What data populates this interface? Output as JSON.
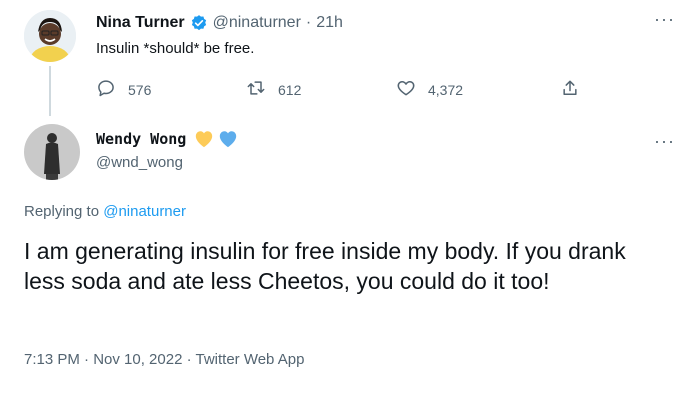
{
  "parent_tweet": {
    "display_name": "Nina Turner",
    "handle": "@ninaturner",
    "time_ago": "21h",
    "separator": "·",
    "text": "Insulin *should* be free.",
    "replies": "576",
    "retweets": "612",
    "likes": "4,372",
    "verified_color": "#1d9bf0"
  },
  "main_tweet": {
    "display_name": "Wendy Wong",
    "emoji_hearts": [
      "yellow-heart",
      "blue-heart"
    ],
    "handle": "@wnd_wong",
    "replying_prefix": "Replying to",
    "replying_to": "@ninaturner",
    "text": "I am generating insulin for free inside my body. If you drank less soda and ate less Cheetos, you could do it too!",
    "timestamp": "7:13 PM · Nov 10, 2022 · Twitter Web App"
  },
  "colors": {
    "link": "#1d9bf0",
    "muted": "#536471",
    "text": "#0f1419"
  }
}
